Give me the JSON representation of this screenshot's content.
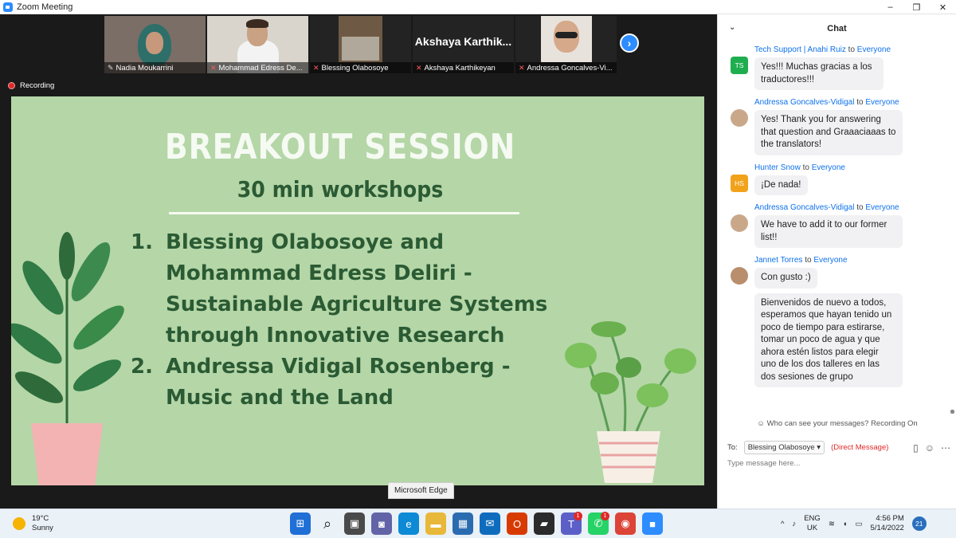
{
  "window": {
    "title": "Zoom Meeting",
    "controls": [
      "–",
      "❐",
      "✕"
    ]
  },
  "gallery": {
    "tiles": [
      {
        "name": "Nadia Moukarrini",
        "muted": false,
        "kind": "video"
      },
      {
        "name": "Mohammad Edress De...",
        "muted": true,
        "kind": "video"
      },
      {
        "name": "Blessing Olabosoye",
        "muted": true,
        "kind": "video"
      },
      {
        "name": "Akshaya Karthikeyan",
        "muted": true,
        "kind": "name",
        "display_name": "Akshaya  Karthik..."
      },
      {
        "name": "Andressa Goncalves-Vi...",
        "muted": true,
        "kind": "video"
      }
    ],
    "next_label": "›"
  },
  "recording": {
    "label": "Recording"
  },
  "slide": {
    "title": "BREAKOUT SESSION",
    "subtitle": "30 min workshops",
    "items": [
      {
        "num": "1.",
        "text": "Blessing Olabosoye and Mohammad Edress Deliri - Sustainable Agriculture Systems through Innovative Research"
      },
      {
        "num": "2.",
        "text": "Andressa Vidigal Rosenberg  - Music and the Land"
      }
    ],
    "colors": {
      "background": "#b5d6a7",
      "title": "#f5faf2",
      "text": "#2b5b34"
    }
  },
  "tooltip": "Microsoft Edge",
  "chat": {
    "title": "Chat",
    "collapse_icon": "⌄",
    "to_word": "to",
    "messages": [
      {
        "sender": "Tech Support | Anahi Ruiz",
        "to": "Everyone",
        "avatar": "TS",
        "avatar_kind": "ts",
        "bubbles": [
          "Yes!!! Muchas gracias a los traductores!!!"
        ]
      },
      {
        "sender": "Andressa Goncalves-Vidigal",
        "to": "Everyone",
        "avatar": "",
        "avatar_kind": "photo",
        "bubbles": [
          "Yes! Thank you for answering that question and Graaaciaaas to the translators!"
        ]
      },
      {
        "sender": "Hunter Snow",
        "to": "Everyone",
        "avatar": "HS",
        "avatar_kind": "hs",
        "bubbles": [
          "¡De nada!"
        ]
      },
      {
        "sender": "Andressa Goncalves-Vidigal",
        "to": "Everyone",
        "avatar": "",
        "avatar_kind": "photo",
        "bubbles": [
          "We have to add it to our former list!!"
        ]
      },
      {
        "sender": "Jannet Torres",
        "to": "Everyone",
        "avatar": "",
        "avatar_kind": "photo2",
        "bubbles": [
          "Con gusto :)",
          "Bienvenidos de nuevo a todos, esperamos que hayan tenido un poco de tiempo para estirarse, tomar un poco de agua y que ahora estén listos para elegir uno de los dos talleres en las dos sesiones de grupo"
        ]
      }
    ],
    "visibility_text": "Who can see your messages? Recording On",
    "to_label": "To:",
    "recipient": "Blessing Olabosoye",
    "direct_message": "(Direct Message)",
    "input_placeholder": "Type message here..."
  },
  "taskbar": {
    "weather": {
      "temp": "19°C",
      "condition": "Sunny"
    },
    "apps": [
      {
        "name": "start",
        "glyph": "⊞",
        "color": "#1f6fd6"
      },
      {
        "name": "search",
        "glyph": "⌕",
        "color": "#333333"
      },
      {
        "name": "file-explorer-multi",
        "glyph": "▣",
        "color": "#4a4a4a"
      },
      {
        "name": "teams-chat",
        "glyph": "◙",
        "color": "#6264a7"
      },
      {
        "name": "edge",
        "glyph": "e",
        "color": "#0c8ad6"
      },
      {
        "name": "file-explorer",
        "glyph": "▬",
        "color": "#e8b83a"
      },
      {
        "name": "store",
        "glyph": "▦",
        "color": "#2b6cb0"
      },
      {
        "name": "mail",
        "glyph": "✉",
        "color": "#0f6cbd"
      },
      {
        "name": "office",
        "glyph": "O",
        "color": "#d83b01"
      },
      {
        "name": "sticky-notes",
        "glyph": "▰",
        "color": "#2b2b2b"
      },
      {
        "name": "teams",
        "glyph": "T",
        "color": "#5b5fc7",
        "badge": "1"
      },
      {
        "name": "whatsapp",
        "glyph": "✆",
        "color": "#25d366",
        "badge": "1"
      },
      {
        "name": "chrome",
        "glyph": "◉",
        "color": "#db4437"
      },
      {
        "name": "zoom",
        "glyph": "■",
        "color": "#2d8cff"
      }
    ],
    "tray": {
      "chevron": "^",
      "lang_line1": "ENG",
      "lang_line2": "UK",
      "time": "4:56 PM",
      "date": "5/14/2022",
      "notifications": "21"
    }
  }
}
